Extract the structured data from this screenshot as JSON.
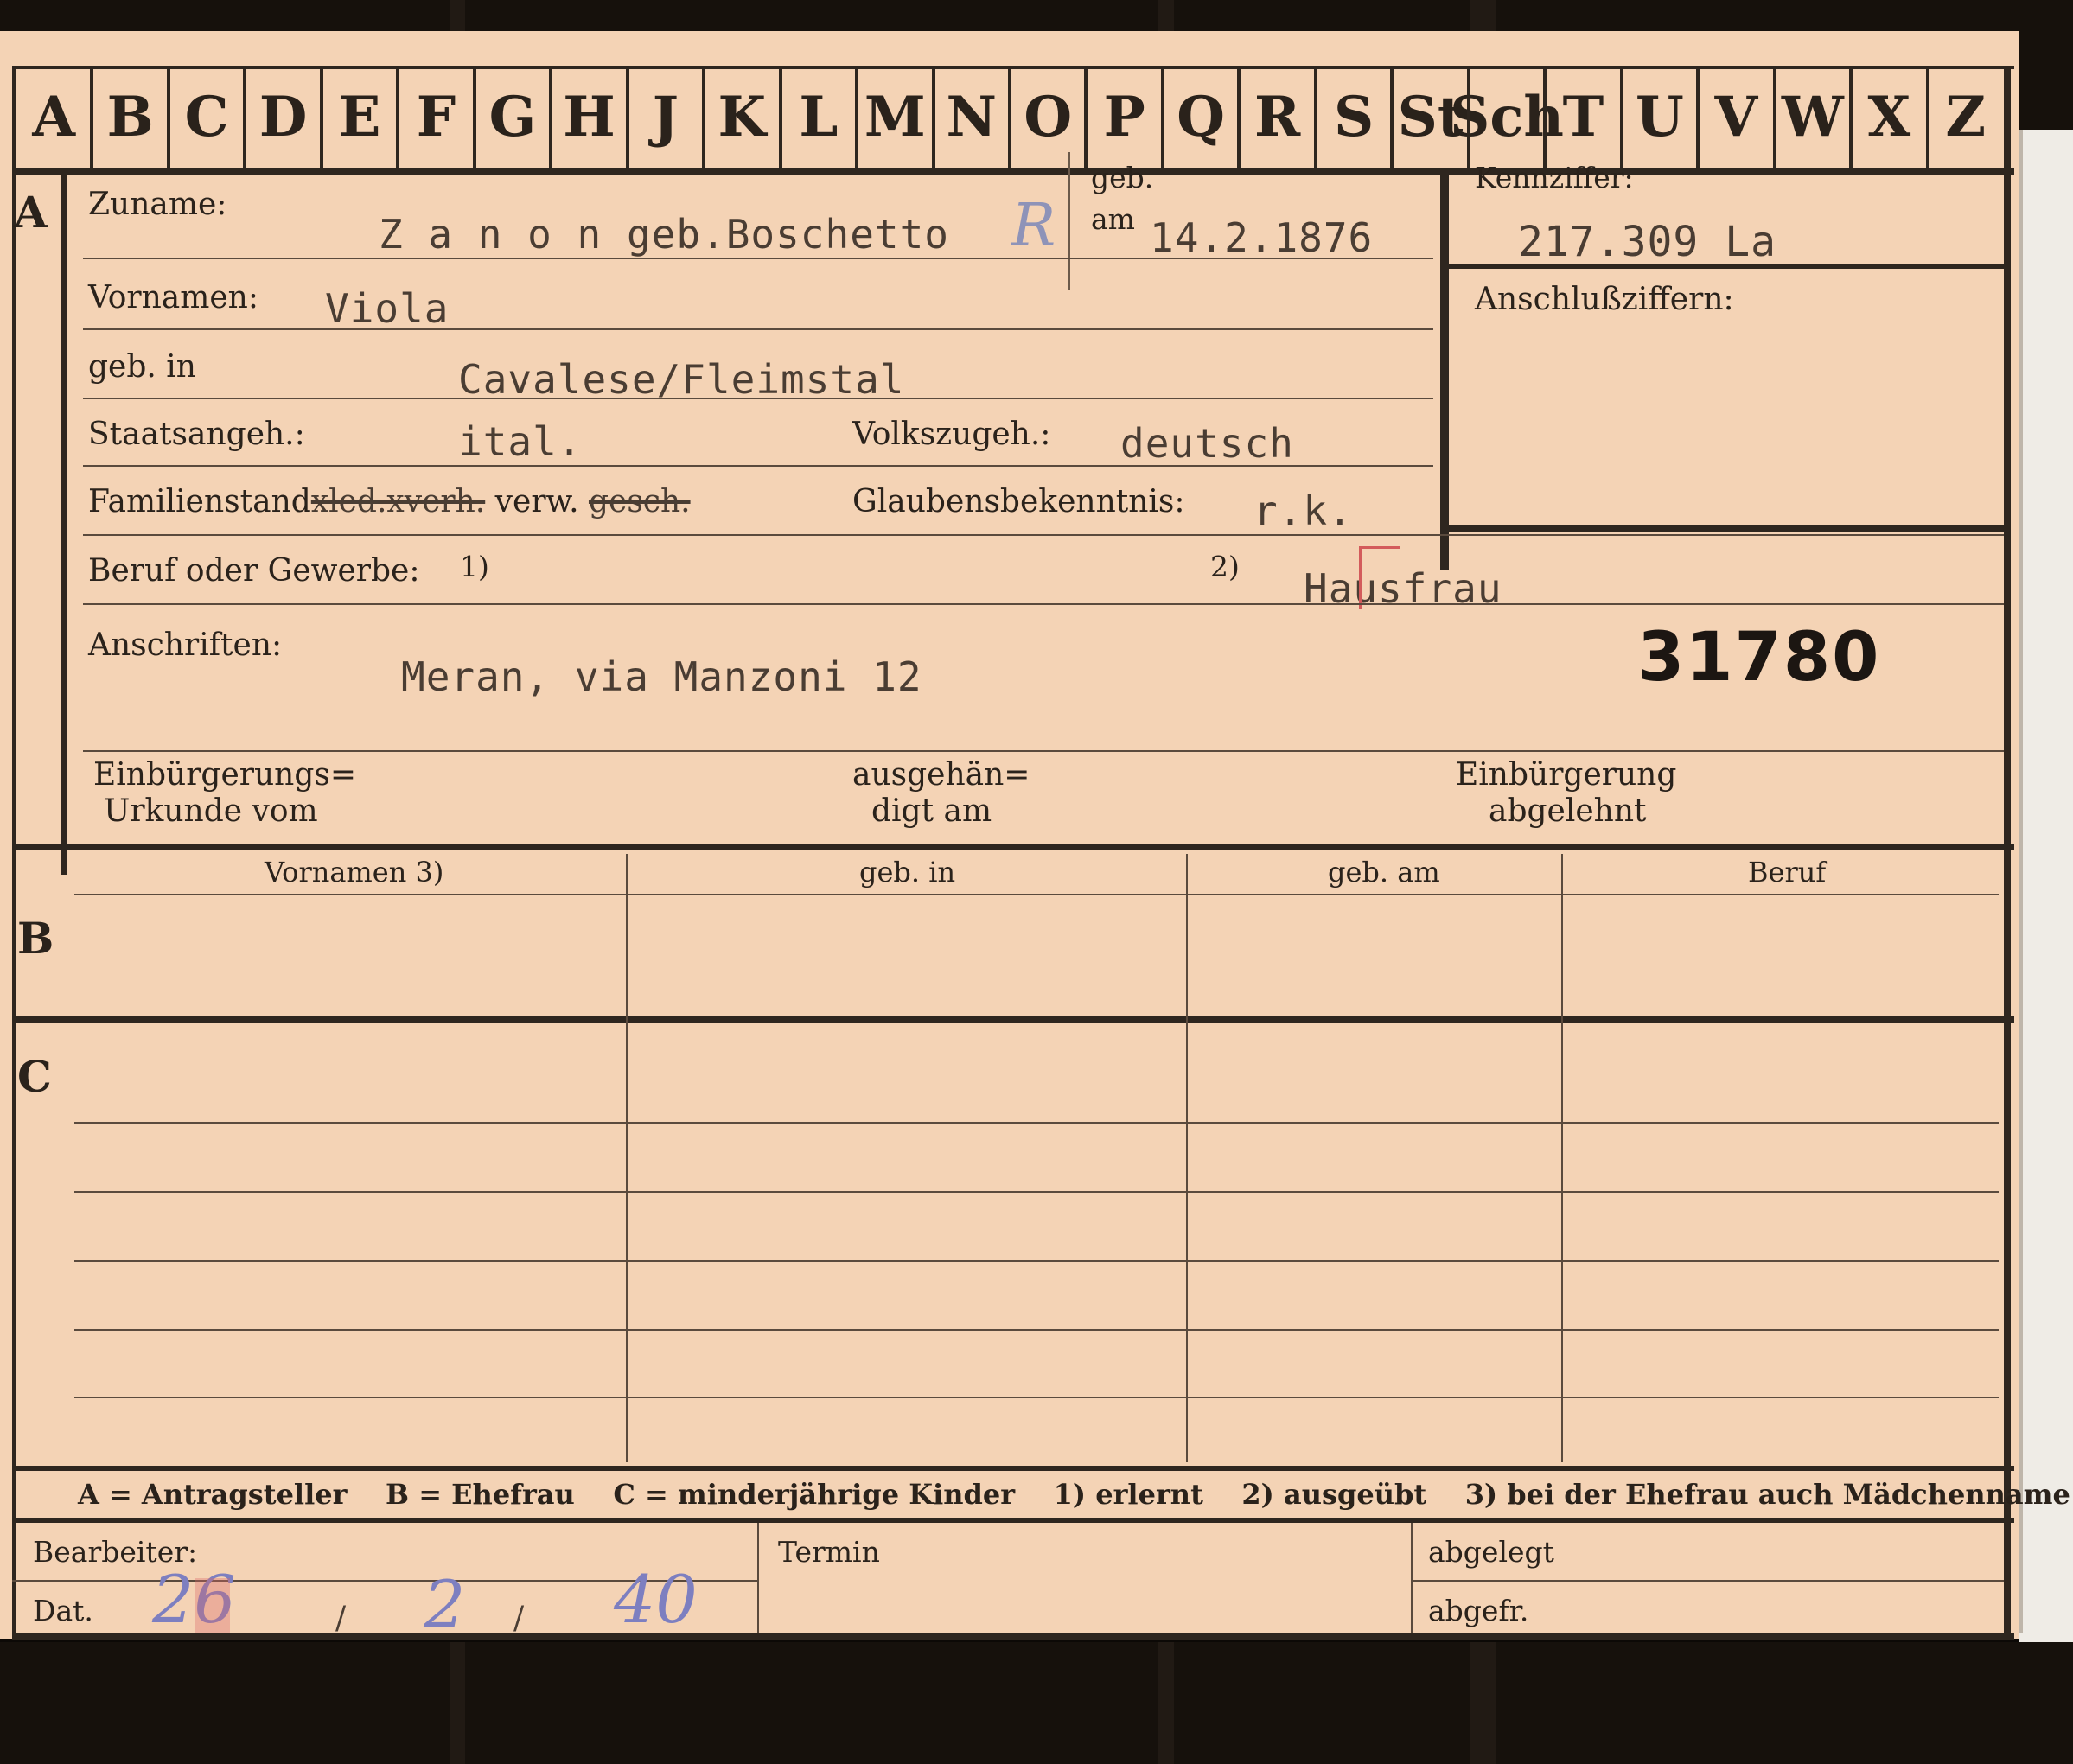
{
  "alphabet": [
    "A",
    "B",
    "C",
    "D",
    "E",
    "F",
    "G",
    "H",
    "J",
    "K",
    "L",
    "M",
    "N",
    "O",
    "P",
    "Q",
    "R",
    "S",
    "St",
    "Sch",
    "T",
    "U",
    "V",
    "W",
    "X",
    "Z"
  ],
  "sections": {
    "a": "A",
    "b": "B",
    "c": "C"
  },
  "fields": {
    "zuname_label": "Zuname:",
    "zuname_value": "Z a n o n  geb.Boschetto",
    "zuname_mark": "R",
    "geb_label": "geb.",
    "am_label": "am",
    "geb_am_value": "14.2.1876",
    "vornamen_label": "Vornamen:",
    "vornamen_value": "Viola",
    "geb_in_label": "geb. in",
    "geb_in_value": "Cavalese/Fleimstal",
    "staatsangeh_label": "Staatsangeh.:",
    "staatsangeh_value": "ital.",
    "volkszugeh_label": "Volkszugeh.:",
    "volkszugeh_value": "deutsch",
    "familienstand_label": "Familienstand",
    "familienstand_struck1": "xled.xverh.",
    "familienstand_verw": "verw.",
    "familienstand_struck2": "gesch.",
    "glaubens_label": "Glaubensbekenntnis:",
    "glaubens_value": "r.k.",
    "beruf_label": "Beruf oder Gewerbe:",
    "beruf_note1": "1)",
    "beruf_note2": "2)",
    "beruf_value": "Hausfrau",
    "anschriften_label": "Anschriften:",
    "anschriften_value": "Meran, via Manzoni  12",
    "stamp_number": "31780",
    "kennziffer_label": "Kennziffer:",
    "kennziffer_value": "217.309   La",
    "anschluss_label": "Anschlußziffern:",
    "einb_urkunde_line1": "Einbürgerungs=",
    "einb_urkunde_line2": "Urkunde vom",
    "ausgehaendigt_line1": "ausgehän=",
    "ausgehaendigt_line2": "digt am",
    "einb_abgelehnt_line1": "Einbürgerung",
    "einb_abgelehnt_line2": "abgelehnt"
  },
  "table_headers": [
    "Vornamen 3)",
    "geb. in",
    "geb. am",
    "Beruf"
  ],
  "legend": {
    "a": "A = Antragsteller",
    "b": "B = Ehefrau",
    "c": "C = minderjährige Kinder",
    "n1": "1) erlernt",
    "n2": "2) ausgeübt",
    "n3": "3) bei der Ehefrau auch Mädchenname"
  },
  "footer": {
    "bearbeiter_label": "Bearbeiter:",
    "dat_label": "Dat.",
    "date_day": "26",
    "date_month": "2",
    "date_year": "40",
    "termin_label": "Termin",
    "abgelegt_label": "abgelegt",
    "abgefr_label": "abgefr."
  },
  "colors": {
    "card": "#f4d3b5",
    "ink": "#2a221b",
    "typewriter": "#4a3d33",
    "pencil_blue": "#7d7fc0",
    "pencil_red": "#d96a6a"
  }
}
